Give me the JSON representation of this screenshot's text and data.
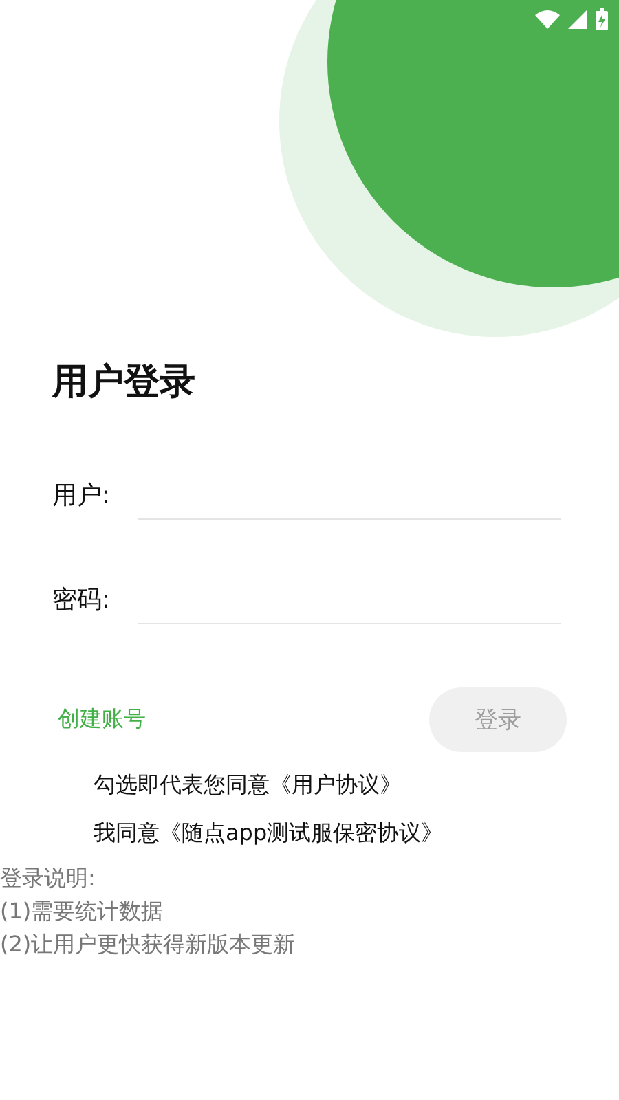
{
  "title": "用户登录",
  "fields": [
    {
      "label": "用户:"
    },
    {
      "label": "密码:"
    }
  ],
  "create_account": "创建账号",
  "login_button": {
    "label": "登录",
    "disabled": true
  },
  "agreements": [
    "勾选即代表您同意《用户协议》",
    "我同意《随点app测试服保密协议》"
  ],
  "notes": [
    "登录说明:",
    "(1)需要统计数据",
    "(2)让用户更快获得新版本更新"
  ]
}
